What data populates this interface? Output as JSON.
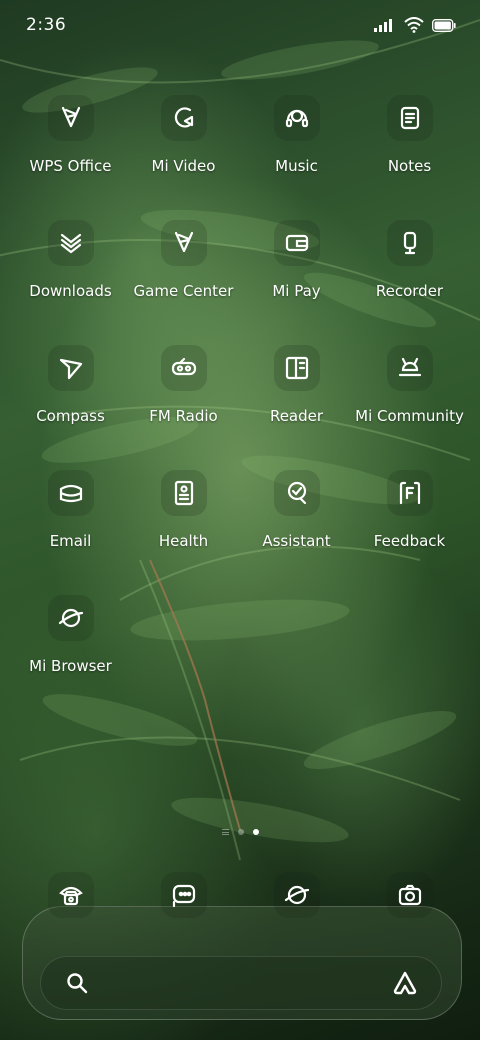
{
  "status_bar": {
    "time": "2:36",
    "icons": [
      "signal-icon",
      "wifi-icon",
      "battery-icon"
    ]
  },
  "apps": [
    {
      "label": "WPS Office",
      "icon": "wps-office-icon"
    },
    {
      "label": "Mi Video",
      "icon": "mi-video-icon"
    },
    {
      "label": "Music",
      "icon": "music-icon"
    },
    {
      "label": "Notes",
      "icon": "notes-icon"
    },
    {
      "label": "Downloads",
      "icon": "downloads-icon"
    },
    {
      "label": "Game Center",
      "icon": "game-center-icon"
    },
    {
      "label": "Mi Pay",
      "icon": "mi-pay-icon"
    },
    {
      "label": "Recorder",
      "icon": "recorder-icon"
    },
    {
      "label": "Compass",
      "icon": "compass-icon"
    },
    {
      "label": "FM Radio",
      "icon": "fm-radio-icon"
    },
    {
      "label": "Reader",
      "icon": "reader-icon"
    },
    {
      "label": "Mi Community",
      "icon": "mi-community-icon"
    },
    {
      "label": "Email",
      "icon": "email-icon"
    },
    {
      "label": "Health",
      "icon": "health-icon"
    },
    {
      "label": "Assistant",
      "icon": "assistant-icon"
    },
    {
      "label": "Feedback",
      "icon": "feedback-icon"
    },
    {
      "label": "Mi Browser",
      "icon": "mi-browser-icon"
    }
  ],
  "page_indicator": {
    "pages": 2,
    "current": 2
  },
  "dock": [
    {
      "icon": "phone-icon"
    },
    {
      "icon": "messages-icon"
    },
    {
      "icon": "browser-icon"
    },
    {
      "icon": "camera-icon"
    }
  ],
  "search": {
    "search_icon": "search-icon",
    "assistant_icon": "app-vault-icon"
  }
}
